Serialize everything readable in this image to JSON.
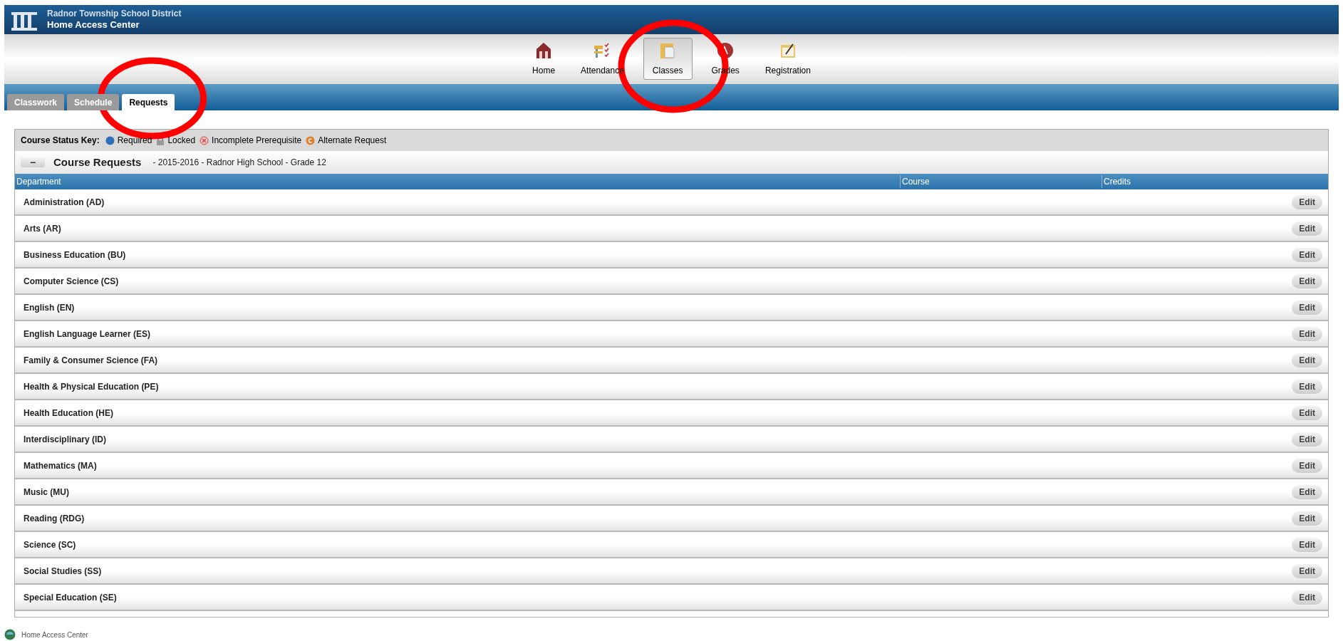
{
  "header": {
    "district": "Radnor Township School District",
    "title": "Home Access Center"
  },
  "nav": [
    {
      "label": "Home",
      "kind": "home",
      "selected": false
    },
    {
      "label": "Attendance",
      "kind": "attendance",
      "selected": false
    },
    {
      "label": "Classes",
      "kind": "classes",
      "selected": true
    },
    {
      "label": "Grades",
      "kind": "grades",
      "selected": false
    },
    {
      "label": "Registration",
      "kind": "registration",
      "selected": false
    }
  ],
  "tabs": [
    {
      "label": "Classwork",
      "selected": false
    },
    {
      "label": "Schedule",
      "selected": false
    },
    {
      "label": "Requests",
      "selected": true
    }
  ],
  "status_key": {
    "label": "Course Status Key:",
    "items": [
      {
        "label": "Required",
        "kind": "required"
      },
      {
        "label": "Locked",
        "kind": "locked"
      },
      {
        "label": "Incomplete Prerequisite",
        "kind": "incomplete"
      },
      {
        "label": "Alternate Request",
        "kind": "alternate"
      }
    ]
  },
  "section": {
    "toggle": "−",
    "title": "Course Requests",
    "subtitle": "- 2015-2016 - Radnor High School - Grade 12",
    "expanded": true
  },
  "table": {
    "columns": [
      "Department",
      "Course",
      "Credits"
    ],
    "rows": [
      {
        "department": "Administration (AD)",
        "action": "Edit"
      },
      {
        "department": "Arts (AR)",
        "action": "Edit"
      },
      {
        "department": "Business Education (BU)",
        "action": "Edit"
      },
      {
        "department": "Computer Science (CS)",
        "action": "Edit"
      },
      {
        "department": "English (EN)",
        "action": "Edit"
      },
      {
        "department": "English Language Learner (ES)",
        "action": "Edit"
      },
      {
        "department": "Family & Consumer Science (FA)",
        "action": "Edit"
      },
      {
        "department": "Health & Physical Education (PE)",
        "action": "Edit"
      },
      {
        "department": "Health Education (HE)",
        "action": "Edit"
      },
      {
        "department": "Interdisciplinary (ID)",
        "action": "Edit"
      },
      {
        "department": "Mathematics (MA)",
        "action": "Edit"
      },
      {
        "department": "Music (MU)",
        "action": "Edit"
      },
      {
        "department": "Reading (RDG)",
        "action": "Edit"
      },
      {
        "department": "Science (SC)",
        "action": "Edit"
      },
      {
        "department": "Social Studies (SS)",
        "action": "Edit"
      },
      {
        "department": "Special Education (SE)",
        "action": "Edit"
      }
    ]
  },
  "footer": {
    "label": "Home Access Center"
  }
}
